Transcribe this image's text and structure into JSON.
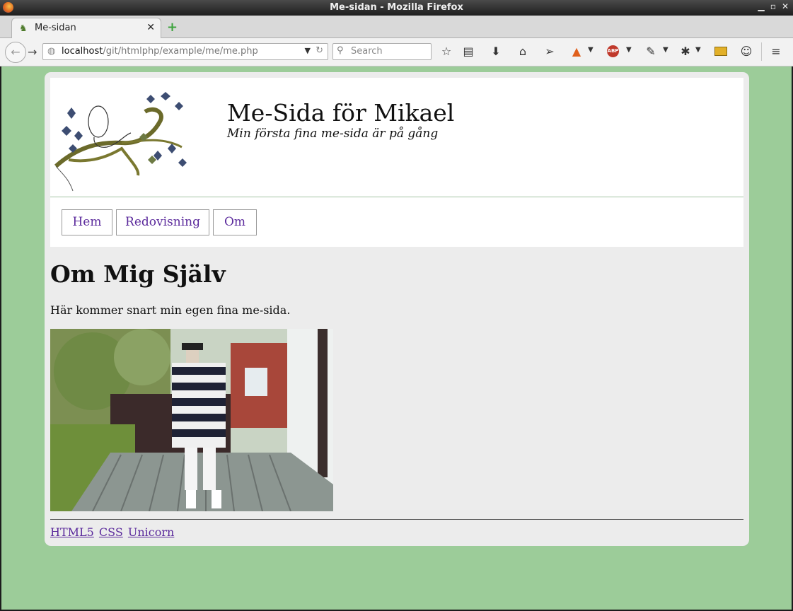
{
  "window": {
    "title": "Me-sidan - Mozilla Firefox"
  },
  "tab": {
    "label": "Me-sidan"
  },
  "address": {
    "host": "localhost",
    "path": "/git/htmlphp/example/me/me.php"
  },
  "search": {
    "placeholder": "Search"
  },
  "toolbar_icons": [
    "bookmark-star-icon",
    "reading-list-icon",
    "download-icon",
    "home-icon",
    "send-icon",
    "extension-icon",
    "adblock-plus-icon",
    "eyedropper-icon",
    "bug-icon",
    "ruler-icon",
    "emoji-icon",
    "menu-icon"
  ],
  "site": {
    "title": "Me-Sida för Mikael",
    "slogan": "Min första fina me-sida är på gång",
    "nav": [
      "Hem",
      "Redovisning",
      "Om"
    ],
    "heading": "Om Mig Själv",
    "intro": "Här kommer snart min egen fina me-sida.",
    "footer_links": [
      "HTML5",
      "CSS",
      "Unicorn"
    ]
  },
  "colors": {
    "background": "#9ccc99",
    "page": "#ececec",
    "link": "#5b2a9c"
  }
}
